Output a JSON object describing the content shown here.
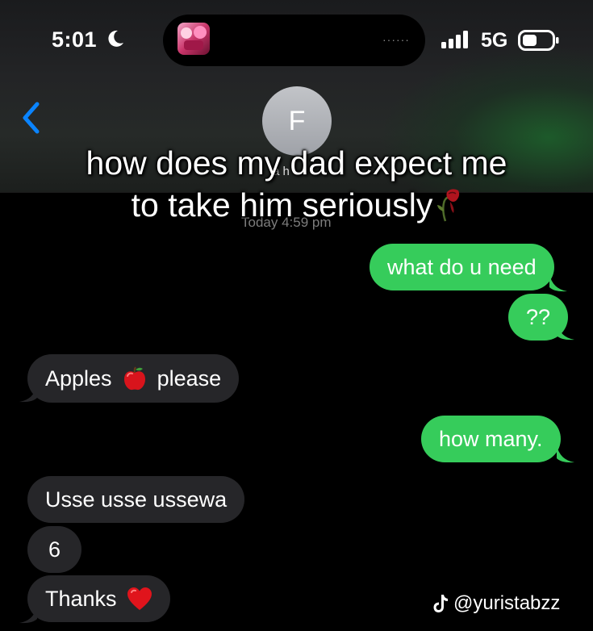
{
  "status_bar": {
    "time": "5:01",
    "network": "5G",
    "island_indicator": "······"
  },
  "header": {
    "avatar_initial": "F",
    "contact_name": "a h",
    "back_icon": "chevron-left-icon"
  },
  "thread": {
    "timestamp": "Today 4:59 pm"
  },
  "caption": {
    "line1": "how does my dad expect me",
    "line2": "to take him seriously"
  },
  "messages": [
    {
      "id": "m1",
      "direction": "outgoing",
      "text": "what do u need"
    },
    {
      "id": "m2",
      "direction": "outgoing",
      "text": "??"
    },
    {
      "id": "m3",
      "direction": "incoming",
      "text_before": "Apples",
      "emoji": "apple-icon",
      "text_after": "please"
    },
    {
      "id": "m4",
      "direction": "outgoing",
      "text": "how many."
    },
    {
      "id": "m5",
      "direction": "incoming",
      "text": "Usse usse ussewa"
    },
    {
      "id": "m6",
      "direction": "incoming",
      "text": "6"
    },
    {
      "id": "m7",
      "direction": "incoming",
      "text": "Thanks",
      "emoji": "heart-icon"
    }
  ],
  "watermark": {
    "handle": "@yuristabzz",
    "icon": "tiktok-icon"
  },
  "colors": {
    "outgoing_bubble": "#36cc5b",
    "incoming_bubble": "#262629",
    "accent_blue": "#0a84ff",
    "background": "#000000"
  }
}
